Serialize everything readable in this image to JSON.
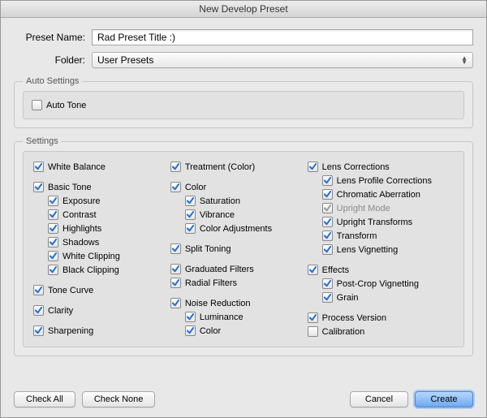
{
  "window": {
    "title": "New Develop Preset"
  },
  "form": {
    "preset_name_label": "Preset Name:",
    "preset_name_value": "Rad Preset Title :)",
    "folder_label": "Folder:",
    "folder_value": "User Presets"
  },
  "auto_settings": {
    "legend": "Auto Settings",
    "auto_tone": {
      "label": "Auto Tone",
      "checked": false
    }
  },
  "settings": {
    "legend": "Settings",
    "col1": {
      "white_balance": {
        "label": "White Balance",
        "checked": true
      },
      "basic_tone": {
        "label": "Basic Tone",
        "checked": true
      },
      "exposure": {
        "label": "Exposure",
        "checked": true
      },
      "contrast": {
        "label": "Contrast",
        "checked": true
      },
      "highlights": {
        "label": "Highlights",
        "checked": true
      },
      "shadows": {
        "label": "Shadows",
        "checked": true
      },
      "white_clipping": {
        "label": "White Clipping",
        "checked": true
      },
      "black_clipping": {
        "label": "Black Clipping",
        "checked": true
      },
      "tone_curve": {
        "label": "Tone Curve",
        "checked": true
      },
      "clarity": {
        "label": "Clarity",
        "checked": true
      },
      "sharpening": {
        "label": "Sharpening",
        "checked": true
      }
    },
    "col2": {
      "treatment": {
        "label": "Treatment (Color)",
        "checked": true
      },
      "color": {
        "label": "Color",
        "checked": true
      },
      "saturation": {
        "label": "Saturation",
        "checked": true
      },
      "vibrance": {
        "label": "Vibrance",
        "checked": true
      },
      "color_adjustments": {
        "label": "Color Adjustments",
        "checked": true
      },
      "split_toning": {
        "label": "Split Toning",
        "checked": true
      },
      "graduated_filters": {
        "label": "Graduated Filters",
        "checked": true
      },
      "radial_filters": {
        "label": "Radial Filters",
        "checked": true
      },
      "noise_reduction": {
        "label": "Noise Reduction",
        "checked": true
      },
      "luminance": {
        "label": "Luminance",
        "checked": true
      },
      "color_nr": {
        "label": "Color",
        "checked": true
      }
    },
    "col3": {
      "lens_corrections": {
        "label": "Lens Corrections",
        "checked": true
      },
      "lens_profile_corrections": {
        "label": "Lens Profile Corrections",
        "checked": true
      },
      "chromatic_aberration": {
        "label": "Chromatic Aberration",
        "checked": true
      },
      "upright_mode": {
        "label": "Upright Mode",
        "checked": true,
        "disabled": true
      },
      "upright_transforms": {
        "label": "Upright Transforms",
        "checked": true
      },
      "transform": {
        "label": "Transform",
        "checked": true
      },
      "lens_vignetting": {
        "label": "Lens Vignetting",
        "checked": true
      },
      "effects": {
        "label": "Effects",
        "checked": true
      },
      "post_crop_vignetting": {
        "label": "Post-Crop Vignetting",
        "checked": true
      },
      "grain": {
        "label": "Grain",
        "checked": true
      },
      "process_version": {
        "label": "Process Version",
        "checked": true
      },
      "calibration": {
        "label": "Calibration",
        "checked": false
      }
    }
  },
  "footer": {
    "check_all": "Check All",
    "check_none": "Check None",
    "cancel": "Cancel",
    "create": "Create"
  }
}
